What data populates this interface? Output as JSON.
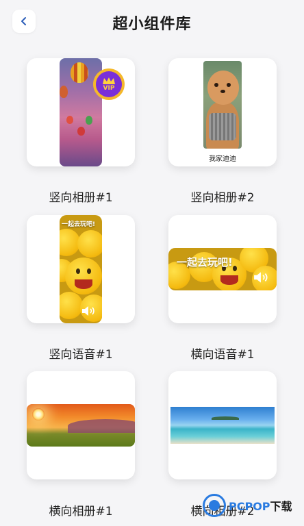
{
  "header": {
    "title": "超小组件库",
    "back_icon": "chevron-left-icon"
  },
  "widgets": [
    {
      "label": "竖向相册#1",
      "badge": "VIP"
    },
    {
      "label": "竖向相册#2",
      "caption": "我家迪迪"
    },
    {
      "label": "竖向语音#1",
      "overlay_text": "一起去玩吧!"
    },
    {
      "label": "横向语音#1",
      "overlay_text": "一起去玩吧!"
    },
    {
      "label": "横向相册#1"
    },
    {
      "label": "横向相册#2"
    }
  ],
  "watermark": {
    "brand": "PCPOP",
    "suffix": "下载"
  },
  "colors": {
    "background": "#f5f5f7",
    "vip_gold": "#f5b82a",
    "vip_purple": "#7a2fd8",
    "watermark_blue": "#2a7be0"
  }
}
